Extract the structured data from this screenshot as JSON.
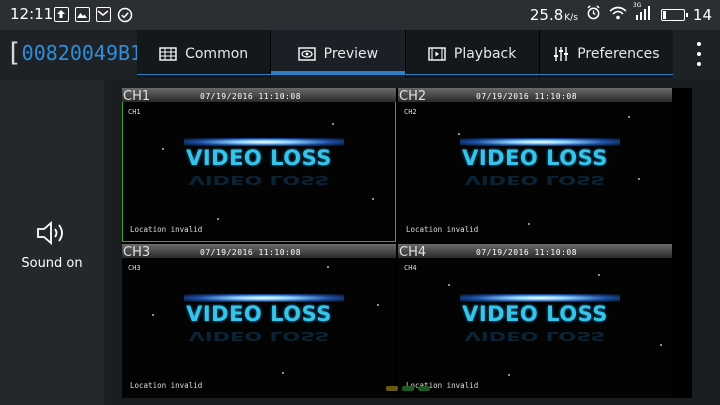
{
  "status_bar": {
    "time": "12:11",
    "speed": "25.8",
    "speed_unit": "K/s",
    "network": "3G",
    "battery": "14"
  },
  "device": {
    "id": "00820049B1",
    "open_bracket": "[",
    "close_bracket": "]"
  },
  "tabs": [
    {
      "label": "Common",
      "icon": "grid-icon"
    },
    {
      "label": "Preview",
      "icon": "eye-icon",
      "active": true
    },
    {
      "label": "Playback",
      "icon": "film-icon"
    },
    {
      "label": "Preferences",
      "icon": "sliders-icon"
    }
  ],
  "sound": {
    "label": "Sound on"
  },
  "channels": [
    {
      "name": "CH1",
      "small": "CH1",
      "timestamp": "07/19/2016  11:10:08",
      "message": "VIDEO LOSS",
      "location": "Location invalid",
      "selected": true
    },
    {
      "name": "CH2",
      "small": "CH2",
      "timestamp": "07/19/2016  11:10:08",
      "message": "VIDEO LOSS",
      "location": "Location invalid"
    },
    {
      "name": "CH3",
      "small": "CH3",
      "timestamp": "07/19/2016  11:10:08",
      "message": "VIDEO LOSS",
      "location": "Location invalid"
    },
    {
      "name": "CH4",
      "small": "CH4",
      "timestamp": "07/19/2016  11:10:08",
      "message": "VIDEO LOSS",
      "location": "Location invalid"
    }
  ],
  "colors": {
    "accent": "#2f7fc4",
    "device_id": "#2e8fd8",
    "video_loss": "#36c4ea",
    "selected_border": "#3ba53b"
  }
}
